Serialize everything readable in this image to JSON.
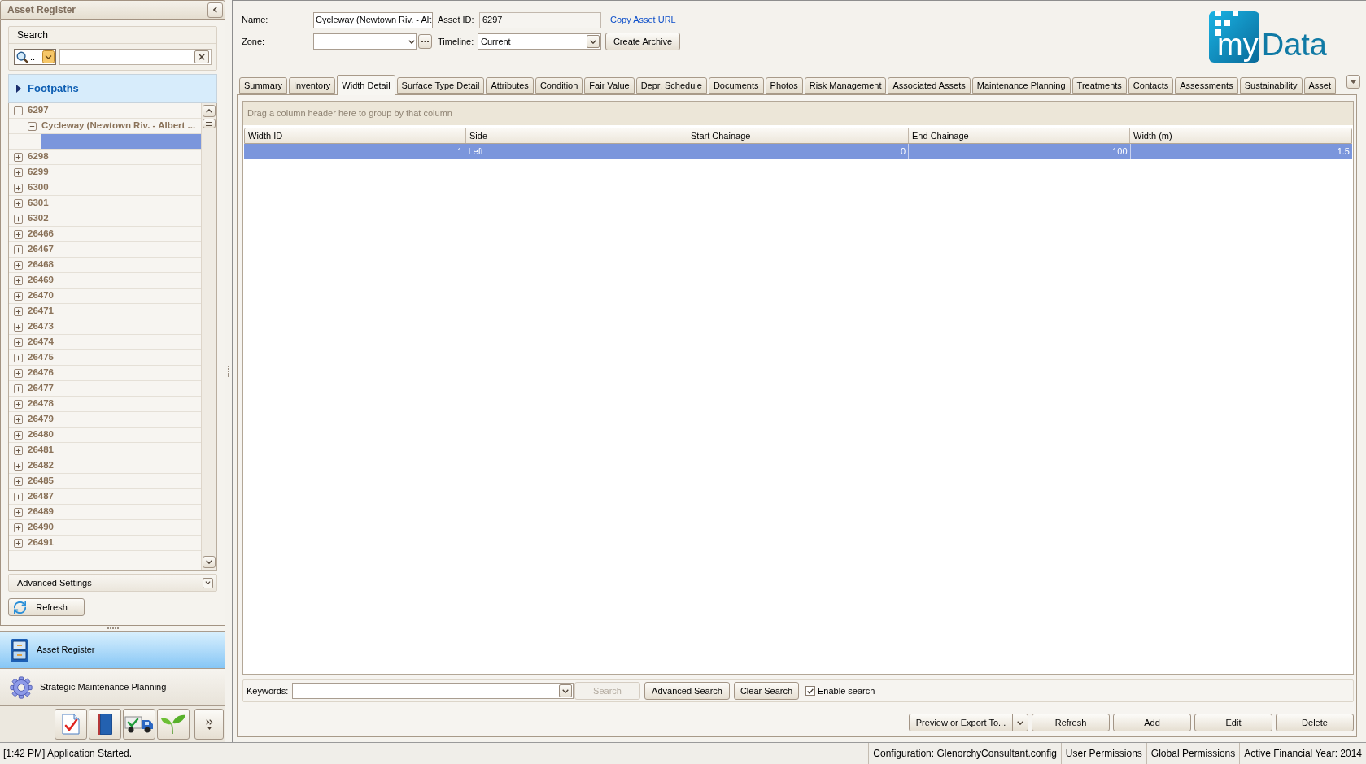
{
  "sidebar": {
    "title": "Asset Register",
    "search": {
      "title": "Search",
      "filter_label": ".."
    },
    "category": {
      "label": "Footpaths",
      "expanded": false
    },
    "tree": [
      {
        "label": "6297",
        "expanded": true,
        "selected": false,
        "children": [
          {
            "label": "Cycleway (Newtown Riv. - Albert ...",
            "expanded": true,
            "selected": false,
            "children": [
              {
                "selected": true
              }
            ]
          }
        ]
      },
      {
        "label": "6298",
        "expanded": false,
        "selected": false
      },
      {
        "label": "6299",
        "expanded": false,
        "selected": false
      },
      {
        "label": "6300",
        "expanded": false,
        "selected": false
      },
      {
        "label": "6301",
        "expanded": false,
        "selected": false
      },
      {
        "label": "6302",
        "expanded": false,
        "selected": false
      },
      {
        "label": "26466",
        "expanded": false,
        "selected": false
      },
      {
        "label": "26467",
        "expanded": false,
        "selected": false
      },
      {
        "label": "26468",
        "expanded": false,
        "selected": false
      },
      {
        "label": "26469",
        "expanded": false,
        "selected": false
      },
      {
        "label": "26470",
        "expanded": false,
        "selected": false
      },
      {
        "label": "26471",
        "expanded": false,
        "selected": false
      },
      {
        "label": "26473",
        "expanded": false,
        "selected": false
      },
      {
        "label": "26474",
        "expanded": false,
        "selected": false
      },
      {
        "label": "26475",
        "expanded": false,
        "selected": false
      },
      {
        "label": "26476",
        "expanded": false,
        "selected": false
      },
      {
        "label": "26477",
        "expanded": false,
        "selected": false
      },
      {
        "label": "26478",
        "expanded": false,
        "selected": false
      },
      {
        "label": "26479",
        "expanded": false,
        "selected": false
      },
      {
        "label": "26480",
        "expanded": false,
        "selected": false
      },
      {
        "label": "26481",
        "expanded": false,
        "selected": false
      },
      {
        "label": "26482",
        "expanded": false,
        "selected": false
      },
      {
        "label": "26485",
        "expanded": false,
        "selected": false
      },
      {
        "label": "26487",
        "expanded": false,
        "selected": false
      },
      {
        "label": "26489",
        "expanded": false,
        "selected": false
      },
      {
        "label": "26490",
        "expanded": false,
        "selected": false
      },
      {
        "label": "26491",
        "expanded": false,
        "selected": false
      }
    ],
    "advanced_settings": {
      "label": "Advanced Settings",
      "expanded": false
    },
    "refresh_button": "Refresh"
  },
  "navigation": [
    {
      "label": "Asset Register",
      "selected": true
    },
    {
      "label": "Strategic Maintenance Planning",
      "selected": false
    }
  ],
  "header": {
    "name": {
      "label": "Name:",
      "value": "Cycleway (Newtown Riv. - Alt"
    },
    "asset_id": {
      "label": "Asset ID:",
      "value": "6297"
    },
    "copy_link": "Copy Asset URL",
    "zone": {
      "label": "Zone:"
    },
    "timeline": {
      "label": "Timeline:",
      "value": "Current"
    },
    "create_archive_button": "Create Archive",
    "logo": {
      "inner": "my",
      "outer": "Data"
    }
  },
  "tabs": [
    {
      "label": "Summary",
      "selected": false
    },
    {
      "label": "Inventory",
      "selected": false
    },
    {
      "label": "Width Detail",
      "selected": true
    },
    {
      "label": "Surface Type Detail",
      "selected": false
    },
    {
      "label": "Attributes",
      "selected": false
    },
    {
      "label": "Condition",
      "selected": false
    },
    {
      "label": "Fair Value",
      "selected": false
    },
    {
      "label": "Depr. Schedule",
      "selected": false
    },
    {
      "label": "Documents",
      "selected": false
    },
    {
      "label": "Photos",
      "selected": false
    },
    {
      "label": "Risk Management",
      "selected": false
    },
    {
      "label": "Associated Assets",
      "selected": false
    },
    {
      "label": "Maintenance Planning",
      "selected": false
    },
    {
      "label": "Treatments",
      "selected": false
    },
    {
      "label": "Contacts",
      "selected": false
    },
    {
      "label": "Assessments",
      "selected": false
    },
    {
      "label": "Sustainability",
      "selected": false
    },
    {
      "label": "Asset",
      "selected": false
    }
  ],
  "grid": {
    "group_hint": "Drag a column header here to group by that column",
    "columns": [
      {
        "label": "Width ID",
        "kind": "number"
      },
      {
        "label": "Side",
        "kind": "text"
      },
      {
        "label": "Start Chainage",
        "kind": "number"
      },
      {
        "label": "End Chainage",
        "kind": "number"
      },
      {
        "label": "Width (m)",
        "kind": "number"
      }
    ],
    "rows": [
      {
        "selected": true,
        "cells": [
          "1",
          "Left",
          "0",
          "100",
          "1.5"
        ]
      }
    ]
  },
  "search_bar": {
    "label": "Keywords:",
    "search_button": {
      "label": "Search",
      "disabled": true
    },
    "advanced_search_button": "Advanced Search",
    "clear_search_button": "Clear Search",
    "enable_search": {
      "label": "Enable search",
      "checked": true
    }
  },
  "actions": {
    "export_button": "Preview or Export To...",
    "buttons": [
      "Refresh",
      "Add",
      "Edit",
      "Delete"
    ]
  },
  "status_bar": {
    "message": "[1:42 PM] Application Started.",
    "panels": [
      "Configuration: GlenorchyConsultant.config",
      "User Permissions",
      "Global Permissions",
      "Active Financial Year: 2014"
    ]
  }
}
